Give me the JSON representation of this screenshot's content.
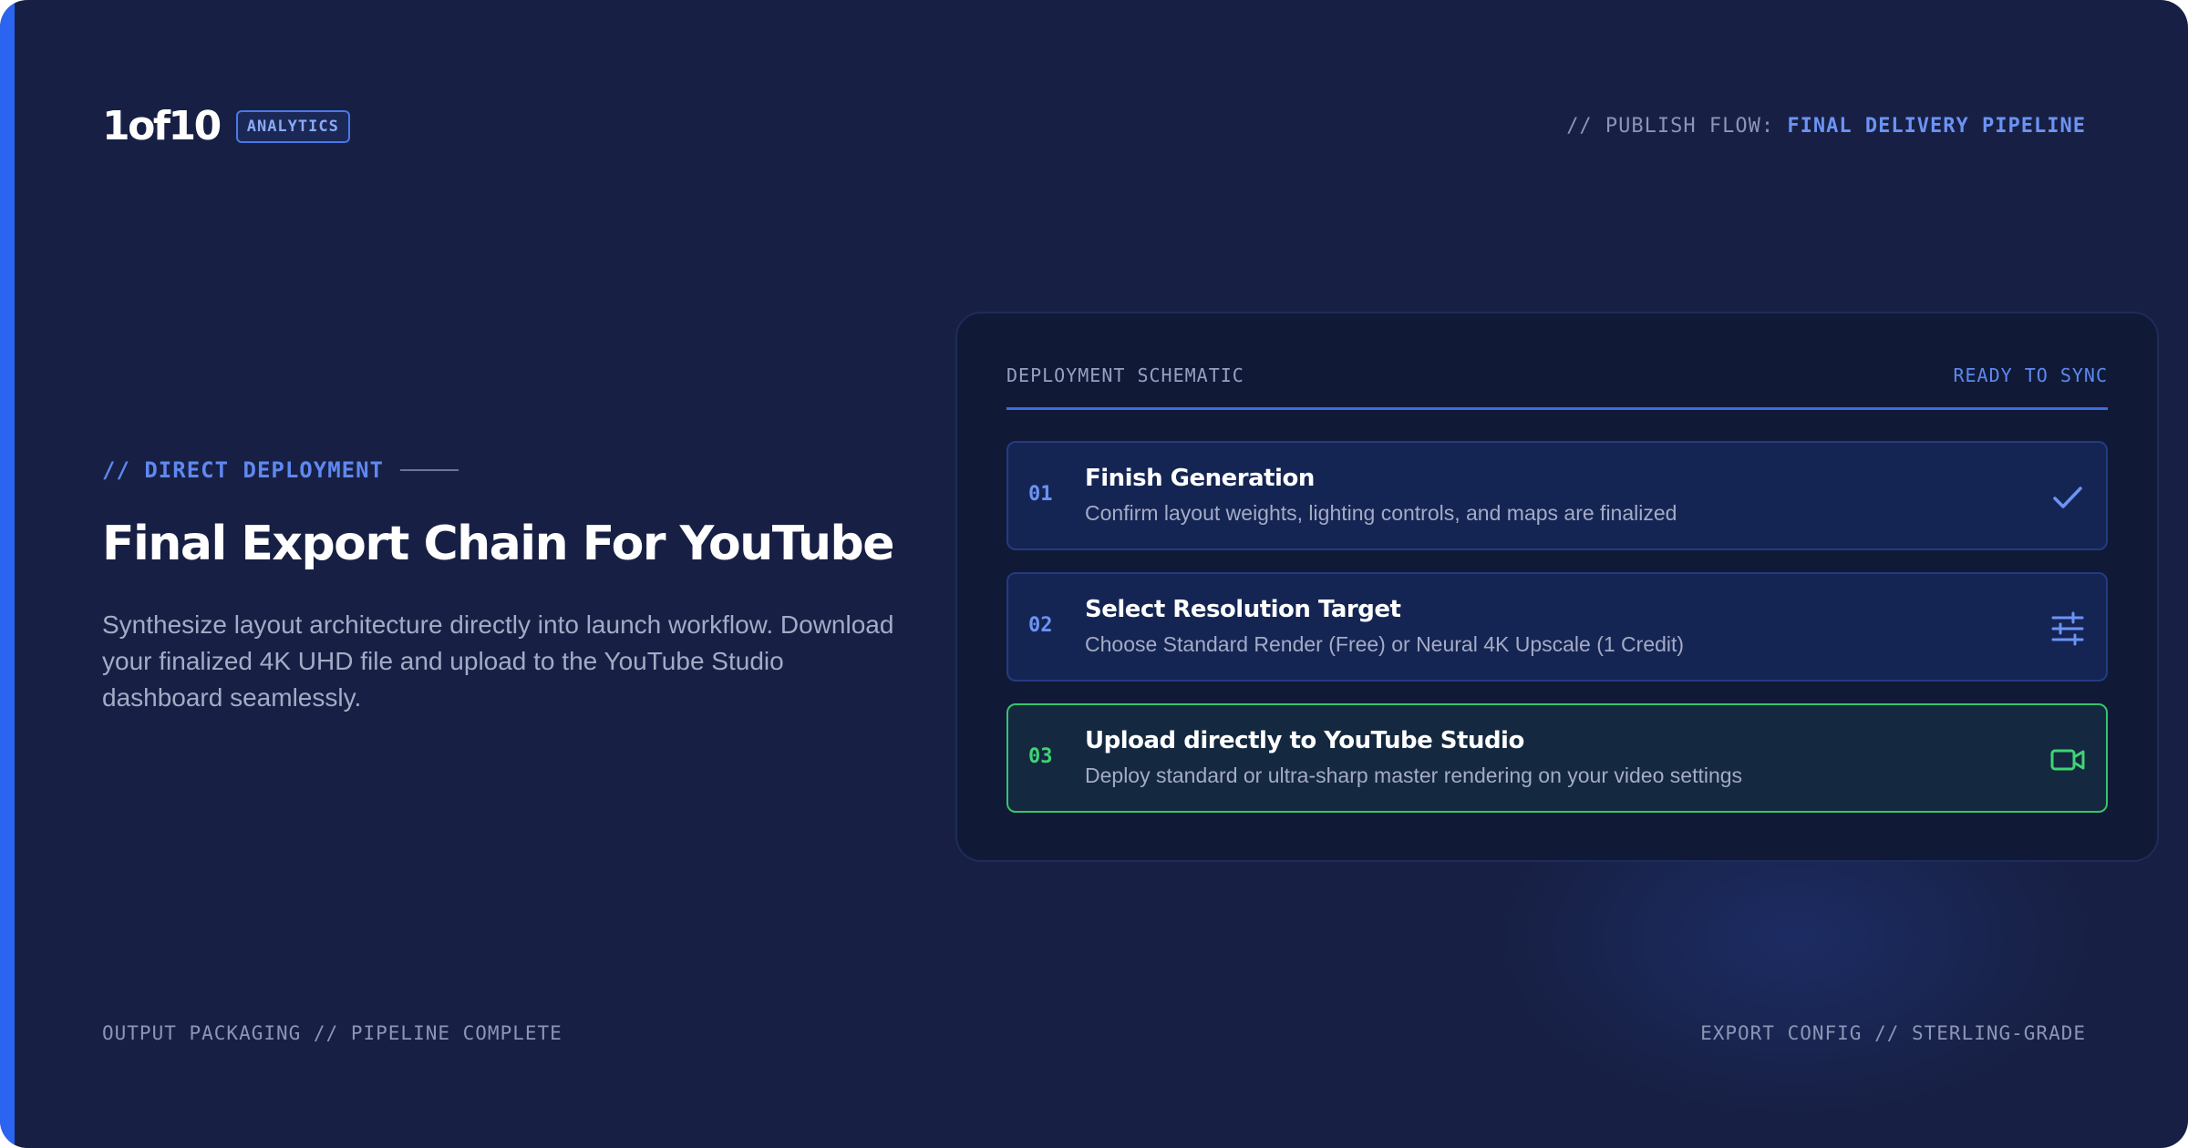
{
  "brand": {
    "logo": "1of10",
    "badge": "ANALYTICS"
  },
  "header": {
    "flow_label": "// PUBLISH FLOW:",
    "flow_value": "FINAL DELIVERY PIPELINE"
  },
  "hero": {
    "eyebrow": "// DIRECT DEPLOYMENT",
    "title": "Final Export Chain For YouTube",
    "subtitle": "Synthesize layout architecture directly into launch workflow. Download your finalized 4K UHD file and upload to the YouTube Studio dashboard seamlessly."
  },
  "panel": {
    "heading": "DEPLOYMENT SCHEMATIC",
    "status": "READY TO SYNC",
    "steps": [
      {
        "number": "01",
        "title": "Finish Generation",
        "description": "Confirm layout weights, lighting controls, and maps are finalized",
        "icon": "check-icon"
      },
      {
        "number": "02",
        "title": "Select Resolution Target",
        "description": "Choose Standard Render (Free) or Neural 4K Upscale (1 Credit)",
        "icon": "sliders-icon"
      },
      {
        "number": "03",
        "title": "Upload directly to YouTube Studio",
        "description": "Deploy standard or ultra-sharp master rendering on your video settings",
        "icon": "video-camera-icon"
      }
    ]
  },
  "footer": {
    "left": "OUTPUT PACKAGING // PIPELINE COMPLETE",
    "right": "EXPORT CONFIG // STERLING-GRADE"
  },
  "colors": {
    "background": "#172044",
    "accent": "#2a64f0",
    "accent_text": "#6c93f5",
    "success": "#36c46b"
  }
}
